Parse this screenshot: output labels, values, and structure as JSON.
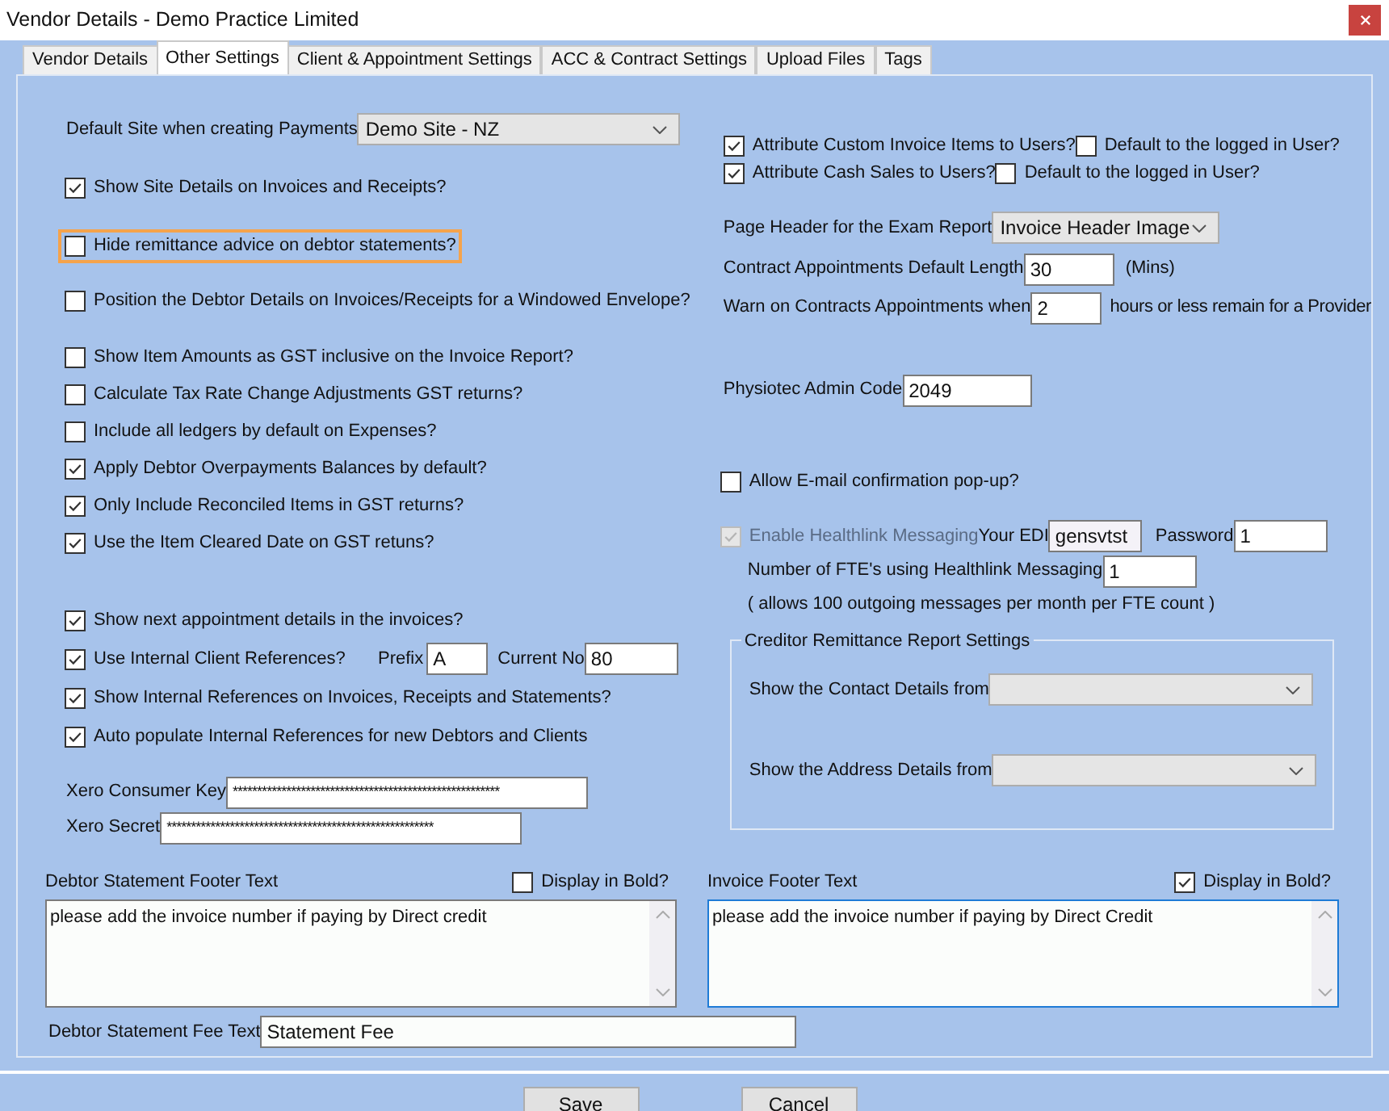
{
  "window": {
    "title": "Vendor Details - Demo Practice Limited"
  },
  "tabs": [
    {
      "label": "Vendor Details",
      "selected": false
    },
    {
      "label": "Other Settings",
      "selected": true
    },
    {
      "label": "Client & Appointment Settings",
      "selected": false
    },
    {
      "label": "ACC & Contract Settings",
      "selected": false
    },
    {
      "label": "Upload Files",
      "selected": false
    },
    {
      "label": "Tags",
      "selected": false
    }
  ],
  "default_site": {
    "label": "Default Site when creating Payments",
    "value": "Demo Site - NZ"
  },
  "option_groups": [
    [
      {
        "kind": "checkbox",
        "label": "Show Site Details on Invoices and Receipts?",
        "checked": true,
        "focused": false
      }
    ],
    [
      {
        "kind": "checkbox",
        "label": "Hide remittance advice on debtor statements?",
        "checked": false,
        "focused": true
      }
    ],
    [
      {
        "kind": "checkbox",
        "label": "Position the Debtor Details on Invoices/Receipts for a Windowed Envelope?",
        "checked": false,
        "focused": false
      }
    ],
    [
      {
        "kind": "checkbox",
        "label": "Show Item Amounts as GST inclusive on the Invoice Report?",
        "checked": false,
        "focused": false
      },
      {
        "kind": "checkbox",
        "label": "Calculate Tax Rate Change Adjustments GST returns?",
        "checked": false,
        "focused": false
      },
      {
        "kind": "checkbox",
        "label": "Include all ledgers by default on Expenses?",
        "checked": false,
        "focused": false
      },
      {
        "kind": "checkbox",
        "label": "Apply Debtor Overpayments Balances by default?",
        "checked": true,
        "focused": false
      },
      {
        "kind": "checkbox",
        "label": "Only Include Reconciled Items in GST returns?",
        "checked": true,
        "focused": false
      },
      {
        "kind": "checkbox",
        "label": "Use the Item Cleared Date on GST retuns?",
        "checked": true,
        "focused": false
      }
    ],
    [
      {
        "kind": "checkbox",
        "label": "Show next appointment details in the invoices?",
        "checked": true,
        "focused": false
      },
      {
        "kind": "reference",
        "label": "Use Internal Client References?",
        "checked": true,
        "focused": false,
        "prefix_label": "Prefix",
        "prefix": "A",
        "current_label": "Current No",
        "current": "80"
      },
      {
        "kind": "checkbox",
        "label": "Show Internal References on Invoices, Receipts and Statements?",
        "checked": true,
        "focused": false
      },
      {
        "kind": "checkbox",
        "label": "Auto populate Internal References for new Debtors and Clients",
        "checked": true,
        "focused": false
      }
    ]
  ],
  "xero": [
    {
      "label": "Xero Consumer Key",
      "value": "*******************************************************"
    },
    {
      "label": "Xero Secret",
      "value": "*******************************************************"
    }
  ],
  "user_attribution": [
    {
      "label": "Attribute Custom Invoice Items to Users?",
      "checked": true,
      "default_label": "Default to the logged in User?",
      "default_checked": false
    },
    {
      "label": "Attribute Cash Sales to Users?",
      "checked": true,
      "default_label": "Default to the logged in User?",
      "default_checked": false
    }
  ],
  "page_header": {
    "label": "Page Header for the Exam Report",
    "value": "Invoice Header Image"
  },
  "contract_length": {
    "label": "Contract Appointments Default Length",
    "value": "30",
    "unit": "(Mins)"
  },
  "warn": {
    "label": "Warn on Contracts Appointments when",
    "value": "2",
    "suffix": "hours or less remain for a Provider"
  },
  "physiotec": {
    "label": "Physiotec Admin Code",
    "value": "2049"
  },
  "email_popup": {
    "label": "Allow E-mail confirmation pop-up?",
    "checked": false
  },
  "healthlink": {
    "label": "Enable Healthlink Messaging",
    "checked": true,
    "disabled": true,
    "edi_label": "Your EDI",
    "edi": "gensvtst",
    "password_label": "Password",
    "password": "1",
    "fte_label": "Number of FTE's using Healthlink Messaging",
    "fte": "1",
    "note": "( allows 100 outgoing messages per month per FTE count )"
  },
  "creditor_remittance": {
    "title": "Creditor Remittance Report Settings",
    "rows": [
      {
        "label": "Show the Contact Details from"
      },
      {
        "label": "Show the Address Details from"
      }
    ]
  },
  "footers": [
    {
      "label": "Debtor Statement Footer Text",
      "bold_label": "Display in Bold?",
      "bold": false,
      "text": "please add the invoice number if paying by Direct credit",
      "focused": false
    },
    {
      "label": "Invoice Footer Text",
      "bold_label": "Display in Bold?",
      "bold": true,
      "text": "please add the invoice number if paying by Direct Credit",
      "focused": true
    }
  ],
  "fee": {
    "label": "Debtor Statement Fee Text",
    "value": "Statement Fee"
  },
  "buttons": [
    "Save",
    "Cancel"
  ]
}
